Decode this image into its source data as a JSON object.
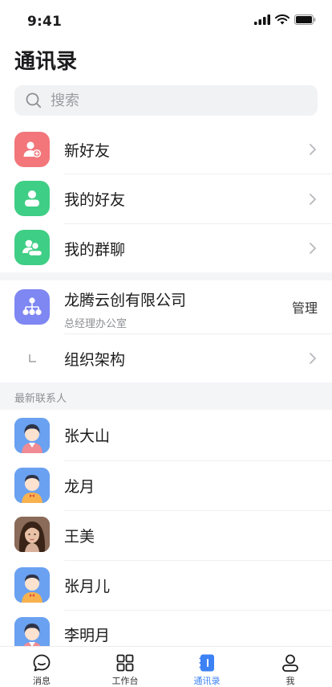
{
  "status_bar": {
    "time": "9:41"
  },
  "page_title": "通讯录",
  "search": {
    "placeholder": "搜索"
  },
  "quick_entries": [
    {
      "label": "新好友",
      "icon": "new-friend-icon",
      "color": "#f2767a"
    },
    {
      "label": "我的好友",
      "icon": "friends-icon",
      "color": "#3fce85"
    },
    {
      "label": "我的群聊",
      "icon": "group-chat-icon",
      "color": "#3fce85"
    }
  ],
  "company": {
    "name": "龙腾云创有限公司",
    "department": "总经理办公室",
    "manage_label": "管理",
    "icon": "org-tree-icon",
    "color": "#7f87f2",
    "org_label": "组织架构"
  },
  "recent_header": "最新联系人",
  "contacts": [
    {
      "name": "张大山",
      "avatar": "avatar-female-cartoon"
    },
    {
      "name": "龙月",
      "avatar": "avatar-male-cartoon"
    },
    {
      "name": "王美",
      "avatar": "avatar-photo"
    },
    {
      "name": "张月儿",
      "avatar": "avatar-male-cartoon"
    },
    {
      "name": "李明月",
      "avatar": "avatar-female-cartoon"
    }
  ],
  "tabbar": {
    "active": "contacts",
    "tabs": [
      {
        "label": "消息",
        "icon": "chat-bubble-icon"
      },
      {
        "label": "工作台",
        "icon": "grid-icon"
      },
      {
        "label": "通讯录",
        "icon": "contacts-book-icon"
      },
      {
        "label": "我",
        "icon": "person-icon"
      }
    ]
  },
  "colors": {
    "accent": "#3d82f5",
    "section_bg": "#f4f5f7"
  }
}
